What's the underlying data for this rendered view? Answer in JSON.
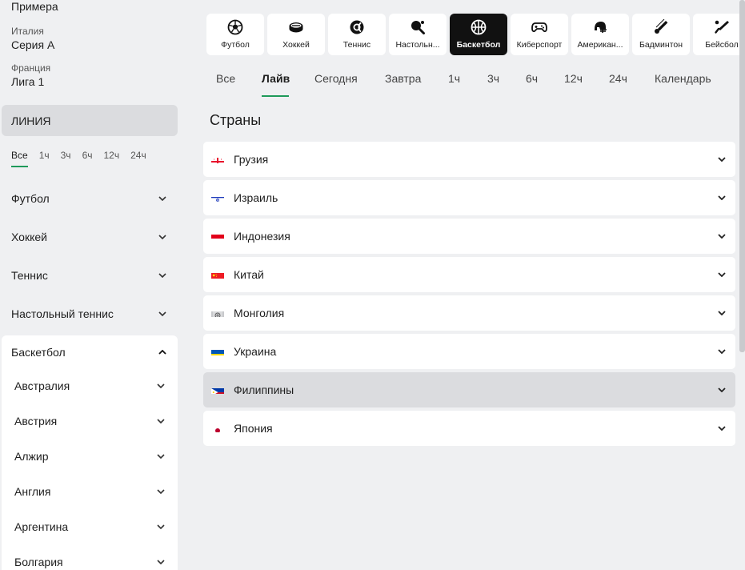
{
  "sidebar": {
    "top_leagues": [
      {
        "country": "",
        "name": "Примера"
      },
      {
        "country": "Италия",
        "name": "Серия А"
      },
      {
        "country": "Франция",
        "name": "Лига 1"
      }
    ],
    "section_label": "ЛИНИЯ",
    "filters": [
      "Все",
      "1ч",
      "3ч",
      "6ч",
      "12ч",
      "24ч"
    ],
    "active_filter": "Все",
    "sports": [
      "Футбол",
      "Хоккей",
      "Теннис",
      "Настольный теннис"
    ],
    "expanded_sport": "Баскетбол",
    "expanded_items": [
      "Австралия",
      "Австрия",
      "Алжир",
      "Англия",
      "Аргентина",
      "Болгария"
    ]
  },
  "sport_tabs": [
    {
      "label": "Футбол",
      "icon": "soccer-ball-icon"
    },
    {
      "label": "Хоккей",
      "icon": "hockey-puck-icon"
    },
    {
      "label": "Теннис",
      "icon": "tennis-ball-icon"
    },
    {
      "label": "Настольн...",
      "icon": "table-tennis-icon"
    },
    {
      "label": "Баскетбол",
      "icon": "basketball-icon",
      "active": true
    },
    {
      "label": "Киберспорт",
      "icon": "gamepad-icon"
    },
    {
      "label": "Американ...",
      "icon": "football-helmet-icon"
    },
    {
      "label": "Бадминтон",
      "icon": "shuttlecock-icon"
    },
    {
      "label": "Бейсбол",
      "icon": "baseball-bat-icon"
    }
  ],
  "time_tabs": [
    "Все",
    "Лайв",
    "Сегодня",
    "Завтра",
    "1ч",
    "3ч",
    "6ч",
    "12ч",
    "24ч",
    "Календарь"
  ],
  "active_time_tab": "Лайв",
  "section_title": "Страны",
  "countries": [
    {
      "name": "Грузия",
      "flag": "georgia-flag"
    },
    {
      "name": "Израиль",
      "flag": "israel-flag"
    },
    {
      "name": "Индонезия",
      "flag": "indonesia-flag"
    },
    {
      "name": "Китай",
      "flag": "china-flag"
    },
    {
      "name": "Монголия",
      "flag": "mongolia-flag"
    },
    {
      "name": "Украина",
      "flag": "ukraine-flag"
    },
    {
      "name": "Филиппины",
      "flag": "philippines-flag",
      "hovered": true
    },
    {
      "name": "Япония",
      "flag": "japan-flag"
    }
  ],
  "colors": {
    "accent": "#1e9a5a",
    "active_tab_bg": "#111111",
    "hover_row": "#dbdcdf",
    "page_bg": "#eff0f2"
  }
}
